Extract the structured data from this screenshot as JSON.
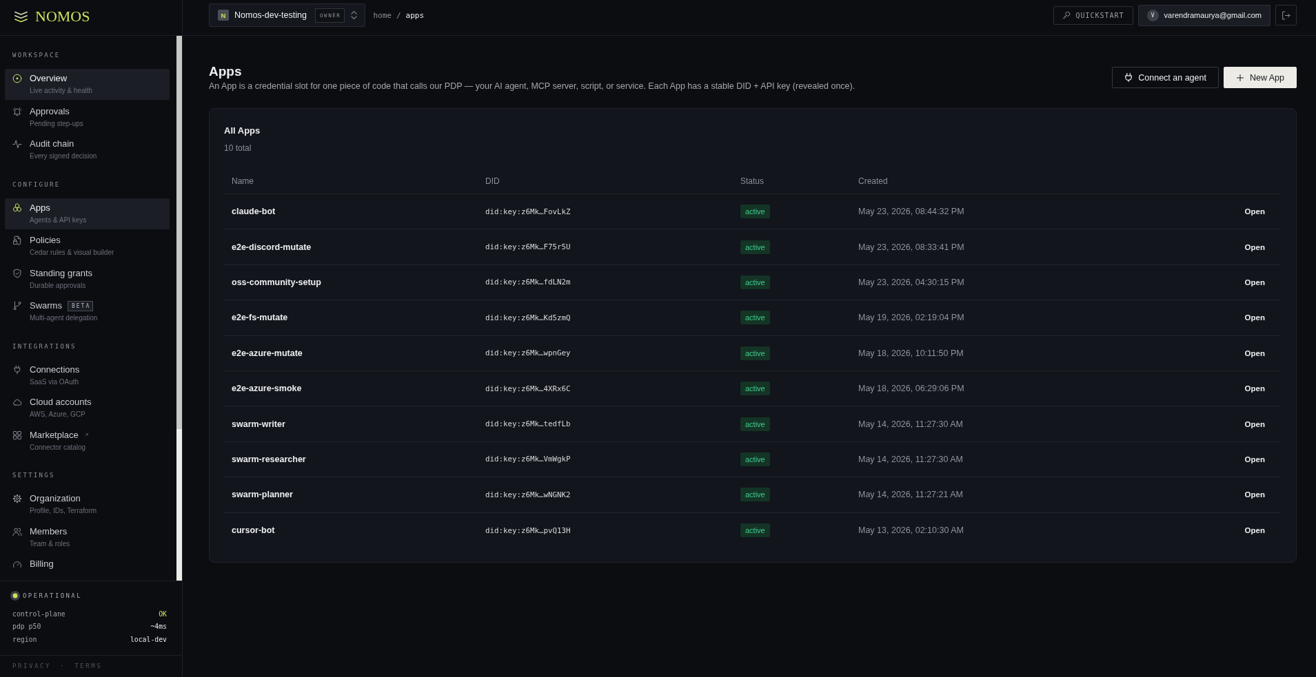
{
  "sidebar": {
    "logo": "NOMOS",
    "sections": [
      {
        "heading": "WORKSPACE",
        "items": [
          {
            "title": "Overview",
            "subtitle": "Live activity & health",
            "selected": true,
            "external": false
          },
          {
            "title": "Approvals",
            "subtitle": "Pending step-ups",
            "selected": false,
            "external": false
          },
          {
            "title": "Audit chain",
            "subtitle": "Every signed decision",
            "selected": false,
            "external": false
          }
        ]
      },
      {
        "heading": "CONFIGURE",
        "items": [
          {
            "title": "Apps",
            "subtitle": "Agents & API keys",
            "selected": true,
            "external": false
          },
          {
            "title": "Policies",
            "subtitle": "Cedar rules & visual builder",
            "selected": false,
            "external": false
          },
          {
            "title": "Standing grants",
            "subtitle": "Durable approvals",
            "selected": false,
            "external": false
          },
          {
            "title": "Swarms",
            "badge": "BETA",
            "subtitle": "Multi-agent delegation",
            "selected": false,
            "external": false
          }
        ]
      },
      {
        "heading": "INTEGRATIONS",
        "items": [
          {
            "title": "Connections",
            "subtitle": "SaaS via OAuth",
            "selected": false,
            "external": false
          },
          {
            "title": "Cloud accounts",
            "subtitle": "AWS, Azure, GCP",
            "selected": false,
            "external": false
          },
          {
            "title": "Marketplace",
            "subtitle": "Connector catalog",
            "selected": false,
            "external": true
          }
        ]
      },
      {
        "heading": "SETTINGS",
        "items": [
          {
            "title": "Organization",
            "subtitle": "Profile, IDs, Terraform",
            "selected": false,
            "external": false
          },
          {
            "title": "Members",
            "subtitle": "Team & roles",
            "selected": false,
            "external": false
          },
          {
            "title": "Billing",
            "selected": false,
            "external": false
          }
        ]
      }
    ],
    "status": {
      "label": "OPERATIONAL",
      "rows": [
        {
          "key": "control-plane",
          "value": "OK",
          "accent": true
        },
        {
          "key": "pdp p50",
          "value": "~4ms",
          "accent": false
        },
        {
          "key": "region",
          "value": "local-dev",
          "accent": false
        }
      ]
    },
    "footer": {
      "links": [
        "PRIVACY",
        "TERMS"
      ],
      "separator": "·"
    }
  },
  "topbar": {
    "org": {
      "initial": "N",
      "name": "Nomos-dev-testing",
      "role": "OWNER"
    },
    "breadcrumb": {
      "separator": "/",
      "items": [
        {
          "label": "home",
          "current": false
        },
        {
          "label": "apps",
          "current": true
        }
      ]
    },
    "quickstart": "QUICKSTART",
    "user": {
      "initial": "V",
      "email": "varendramaurya@gmail.com"
    }
  },
  "page": {
    "title": "Apps",
    "description": "An App is a credential slot for one piece of code that calls our PDP — your AI agent, MCP server, script, or service. Each App has a stable DID + API key (revealed once).",
    "actions": [
      {
        "label": "Connect an agent",
        "kind": "secondary"
      },
      {
        "label": "New App",
        "kind": "primary"
      }
    ],
    "card": {
      "title": "All Apps",
      "count": "10 total",
      "table": {
        "columns": [
          "Name",
          "DID",
          "Status",
          "Created"
        ],
        "rows": [
          {
            "name": "claude-bot",
            "did": "did:key:z6Mk…FovLkZ",
            "status": "active",
            "created": "May 23, 2026, 08:44:32 PM",
            "action": "Open"
          },
          {
            "name": "e2e-discord-mutate",
            "did": "did:key:z6Mk…F75r5U",
            "status": "active",
            "created": "May 23, 2026, 08:33:41 PM",
            "action": "Open"
          },
          {
            "name": "oss-community-setup",
            "did": "did:key:z6Mk…fdLN2m",
            "status": "active",
            "created": "May 23, 2026, 04:30:15 PM",
            "action": "Open"
          },
          {
            "name": "e2e-fs-mutate",
            "did": "did:key:z6Mk…Kd5zmQ",
            "status": "active",
            "created": "May 19, 2026, 02:19:04 PM",
            "action": "Open"
          },
          {
            "name": "e2e-azure-mutate",
            "did": "did:key:z6Mk…wpnGey",
            "status": "active",
            "created": "May 18, 2026, 10:11:50 PM",
            "action": "Open"
          },
          {
            "name": "e2e-azure-smoke",
            "did": "did:key:z6Mk…4XRx6C",
            "status": "active",
            "created": "May 18, 2026, 06:29:06 PM",
            "action": "Open"
          },
          {
            "name": "swarm-writer",
            "did": "did:key:z6Mk…tedfLb",
            "status": "active",
            "created": "May 14, 2026, 11:27:30 AM",
            "action": "Open"
          },
          {
            "name": "swarm-researcher",
            "did": "did:key:z6Mk…VmWgkP",
            "status": "active",
            "created": "May 14, 2026, 11:27:30 AM",
            "action": "Open"
          },
          {
            "name": "swarm-planner",
            "did": "did:key:z6Mk…wNGNK2",
            "status": "active",
            "created": "May 14, 2026, 11:27:21 AM",
            "action": "Open"
          },
          {
            "name": "cursor-bot",
            "did": "did:key:z6Mk…pvQ13H",
            "status": "active",
            "created": "May 13, 2026, 02:10:30 AM",
            "action": "Open"
          }
        ]
      }
    }
  }
}
